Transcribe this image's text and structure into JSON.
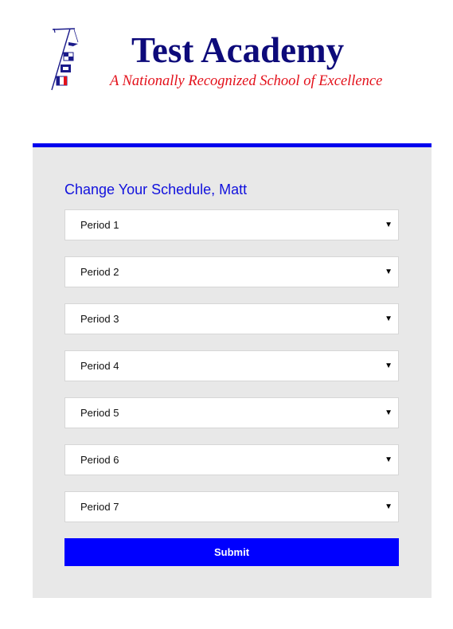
{
  "header": {
    "title": "Test Academy",
    "tagline": "A Nationally Recognized School of Excellence",
    "logo_icon": "nautical-flags-mast-icon",
    "title_color": "#0d0a7a",
    "tagline_color": "#e3101a"
  },
  "form": {
    "heading": "Change Your Schedule, Matt",
    "accent_color": "#0000ee",
    "periods": [
      {
        "label": "Period 1"
      },
      {
        "label": "Period 2"
      },
      {
        "label": "Period 3"
      },
      {
        "label": "Period 4"
      },
      {
        "label": "Period 5"
      },
      {
        "label": "Period 6"
      },
      {
        "label": "Period 7"
      }
    ],
    "submit_label": "Submit",
    "submit_color": "#0000ff"
  }
}
